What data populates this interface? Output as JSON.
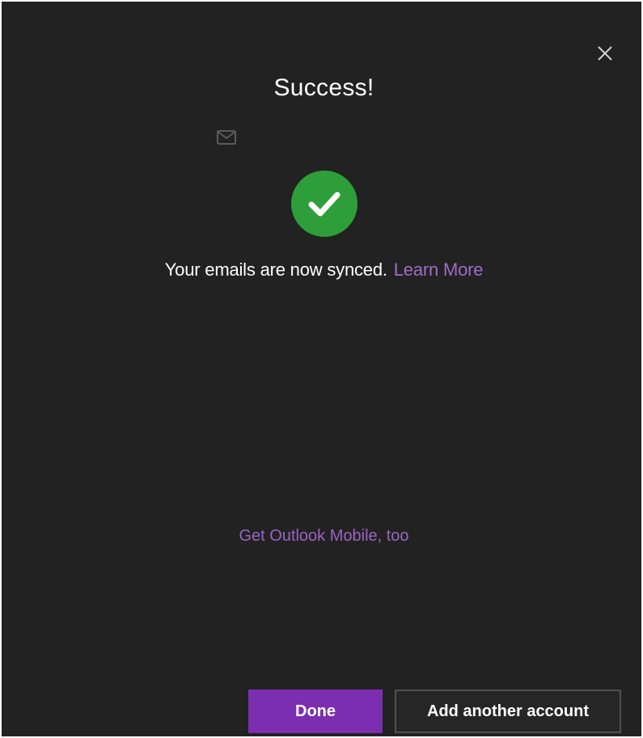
{
  "dialog": {
    "title": "Success!",
    "status_text": "Your emails are now synced.",
    "learn_more_link": "Learn More",
    "mobile_link": "Get Outlook Mobile, too",
    "buttons": {
      "done": "Done",
      "add_account": "Add another account"
    },
    "icons": {
      "close": "close-icon",
      "mail": "mail-icon",
      "success": "checkmark-circle-icon"
    },
    "colors": {
      "background": "#222222",
      "accent": "#7b2fb0",
      "link": "#a06cc7",
      "success": "#2e9e3a"
    }
  }
}
